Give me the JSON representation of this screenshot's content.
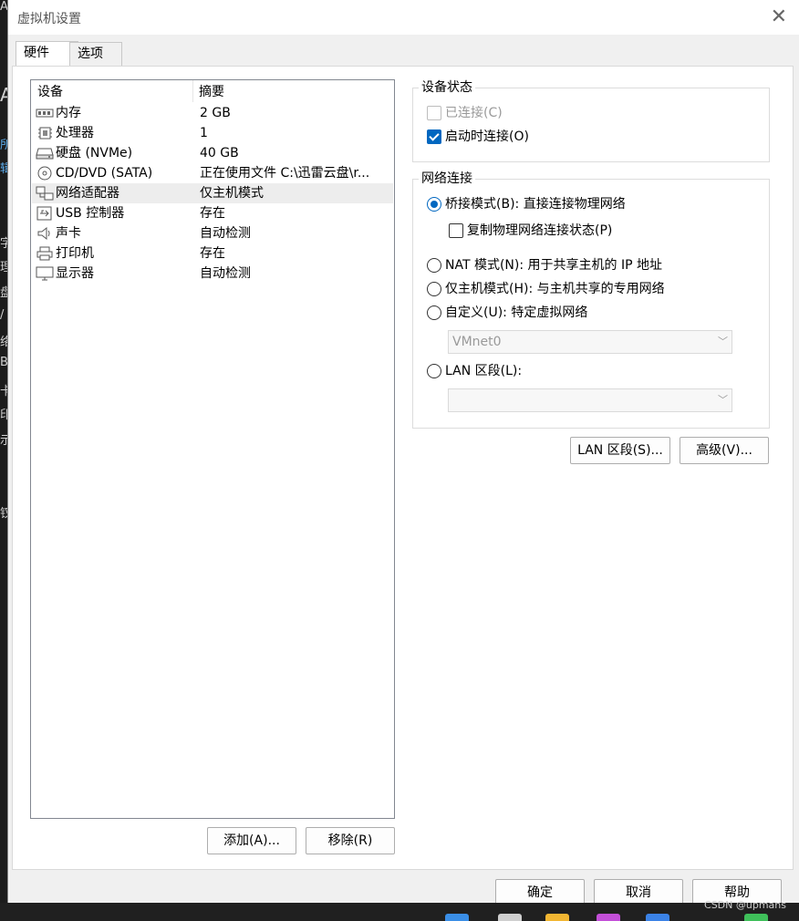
{
  "background_fragments": [
    "A",
    "所",
    "辑",
    "字",
    "理",
    "盘",
    "/",
    "络",
    "B",
    "卡",
    "印",
    "示",
    "钗"
  ],
  "window": {
    "title": "虚拟机设置",
    "close_glyph": "✕"
  },
  "tabs": [
    {
      "label": "硬件"
    },
    {
      "label": "选项"
    }
  ],
  "device_list": {
    "headers": {
      "device": "设备",
      "summary": "摘要"
    },
    "rows": [
      {
        "name": "内存",
        "summary": "2 GB",
        "icon": "memory-icon"
      },
      {
        "name": "处理器",
        "summary": "1",
        "icon": "cpu-icon"
      },
      {
        "name": "硬盘 (NVMe)",
        "summary": "40 GB",
        "icon": "harddisk-icon"
      },
      {
        "name": "CD/DVD (SATA)",
        "summary": "正在使用文件 C:\\迅雷云盘\\r...",
        "icon": "cdrom-icon"
      },
      {
        "name": "网络适配器",
        "summary": "仅主机模式",
        "icon": "network-icon"
      },
      {
        "name": "USB 控制器",
        "summary": "存在",
        "icon": "usb-icon"
      },
      {
        "name": "声卡",
        "summary": "自动检测",
        "icon": "speaker-icon"
      },
      {
        "name": "打印机",
        "summary": "存在",
        "icon": "printer-icon"
      },
      {
        "name": "显示器",
        "summary": "自动检测",
        "icon": "monitor-icon"
      }
    ],
    "selected": "网络适配器"
  },
  "list_buttons": {
    "add": "添加(A)...",
    "remove": "移除(R)"
  },
  "device_status": {
    "title": "设备状态",
    "connected": {
      "label": "已连接(C)",
      "checked": false,
      "disabled": true
    },
    "connect_at_power_on": {
      "label": "启动时连接(O)",
      "checked": true
    }
  },
  "network": {
    "title": "网络连接",
    "bridged": {
      "label": "桥接模式(B): 直接连接物理网络",
      "selected": true
    },
    "replicate": {
      "label": "复制物理网络连接状态(P)",
      "checked": false
    },
    "nat": {
      "label": "NAT 模式(N): 用于共享主机的 IP 地址",
      "selected": false
    },
    "hostonly": {
      "label": "仅主机模式(H): 与主机共享的专用网络",
      "selected": false
    },
    "custom": {
      "label": "自定义(U): 特定虚拟网络",
      "selected": false,
      "value": "VMnet0"
    },
    "lan": {
      "label": "LAN 区段(L):",
      "selected": false,
      "value": ""
    }
  },
  "right_buttons": {
    "lan_segments": "LAN 区段(S)...",
    "advanced": "高级(V)..."
  },
  "footer_buttons": {
    "ok": "确定",
    "cancel": "取消",
    "help": "帮助"
  },
  "watermark": "CSDN @upmans",
  "colors": {
    "accent": "#0067c0"
  }
}
